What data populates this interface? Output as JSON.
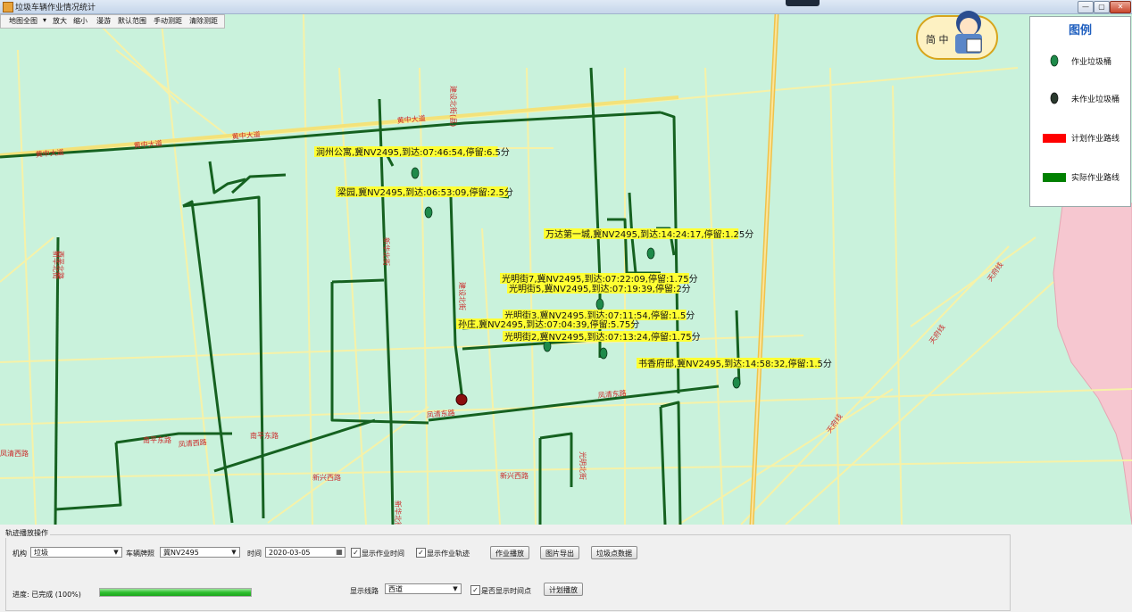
{
  "window": {
    "title": "垃圾车辆作业情况统计"
  },
  "menu": [
    "地图全图",
    "放大",
    "缩小",
    "漫游",
    "默认范围",
    "手动测距",
    "清除测距"
  ],
  "legend": {
    "title": "图例",
    "items": [
      "作业垃圾桶",
      "未作业垃圾桶",
      "计划作业路线",
      "实际作业路线"
    ],
    "colors": [
      "#1e8a4a",
      "#2a3a2e",
      "#ff0000",
      "#008000"
    ]
  },
  "mascot": {
    "text": "简 中",
    "icon": "mascot-icon"
  },
  "map": {
    "colors": {
      "background": "#c9f2dc",
      "road_minor": "#f6f2a8",
      "road_major": "#f0c24a",
      "route": "#0c5a16",
      "label_bg": "#ffff33",
      "zone": "#f6c7d0"
    },
    "stops": [
      "润州公寓,冀NV2495,到达:07:46:54,停留:6.5分",
      "梁园,冀NV2495,到达:06:53:09,停留:2.5分",
      "万达第一城,冀NV2495,到达:14:24:17,停留:1.25分",
      "光明街7,冀NV2495,到达:07:22:09,停留:1.75分",
      "光明街5,冀NV2495,到达:07:19:39,停留:2分",
      "光明街3,冀NV2495,到达:07:11:54,停留:1.5分",
      "孙庄,冀NV2495,到达:07:04:39,停留:5.75分",
      "光明街2,冀NV2495,到达:07:13:24,停留:1.75分",
      "书香府邸,冀NV2495,到达:14:58:32,停留:1.5分"
    ],
    "street_labels": [
      "黄中大道",
      "黄中大道",
      "黄中大道",
      "黄中大道",
      "建设北街(县)",
      "建设北街",
      "新华北街",
      "新华北街",
      "凤清东路",
      "凤清东路",
      "凤清西路",
      "凤清西路",
      "南平东路",
      "南平东路",
      "新兴西路",
      "新兴西路",
      "民生路",
      "光明北街",
      "天府线",
      "天府线",
      "天府线",
      "新华北街",
      "西平北路"
    ]
  },
  "controls": {
    "group_title": "轨迹播放操作",
    "org_label": "机构",
    "org_value": "垃圾",
    "vehicle_label": "车辆牌照",
    "vehicle_value": "冀NV2495",
    "time_label": "时间",
    "date_value": "2020-03-05",
    "show_work_time_label": "显示作业时间",
    "show_work_track_label": "显示作业轨迹",
    "btn_play": "作业播放",
    "btn_export": "图片导出",
    "btn_points": "垃圾点数据",
    "progress_label": "进度: 已完成 (100%)",
    "progress_value": 1.0,
    "route_label": "显示线路",
    "route_value": "西道",
    "show_time_points_label": "是否显示时间点",
    "btn_plan_play": "计划播放"
  }
}
